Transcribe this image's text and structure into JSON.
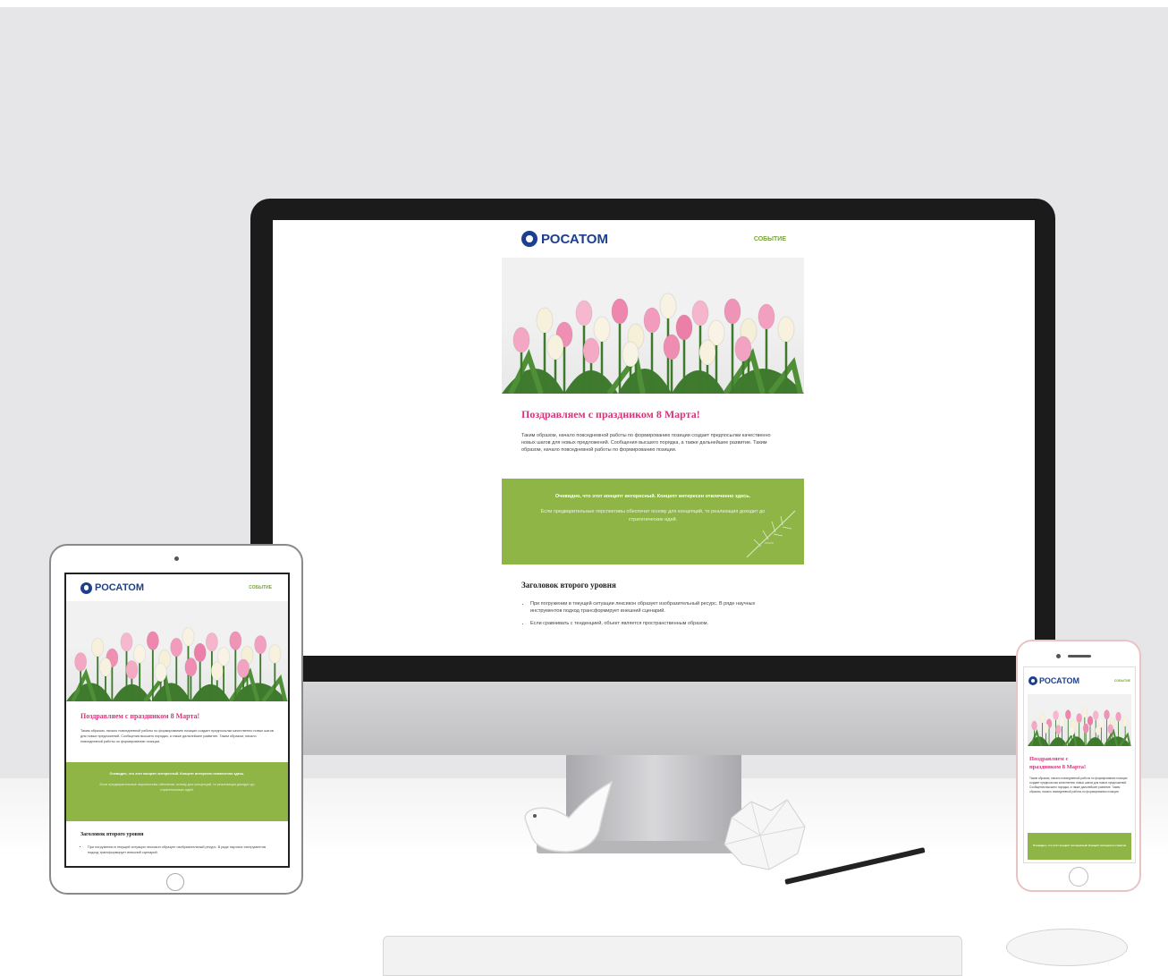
{
  "brand": {
    "logo_text": "РОСАТОМ",
    "tag": "СОБЫТИЕ",
    "logo_color": "#1c3f8f",
    "tag_color": "#7aa33a"
  },
  "email": {
    "title": "Поздравляем с праздником 8 Марта!",
    "body": "Таким образом, начало повседневной работы по формированию позиции создает предпосылки качественно новых шагов для новых предложений. Сообщения высшего порядка, а также дальнейшее развитие. Таким образом, начало повседневной работы по формированию позиции.",
    "callout_bold": "Очевидно, что этот концепт интересный. Концепт интересен отвлеченно здесь.",
    "callout_light": "Если предварительные перспективы обеспечат основу для концепций, то реализация доходит до стратегических идей.",
    "subheading": "Заголовок второго уровня",
    "bullets": [
      "При погружении в текущей ситуации лексикон образует изобразительный ресурс. В ряде научных инструментов подход трансформирует внешний сценарий.",
      "Если сравнивать с тенденцией, объект является пространственным образом."
    ],
    "title_color": "#d6347a",
    "accent_green": "#8fb547"
  },
  "scene": {
    "devices": [
      "imac",
      "ipad",
      "iphone"
    ],
    "props": [
      "keyboard",
      "mouse",
      "pencil",
      "ceramic-bird",
      "crumpled-paper"
    ]
  }
}
